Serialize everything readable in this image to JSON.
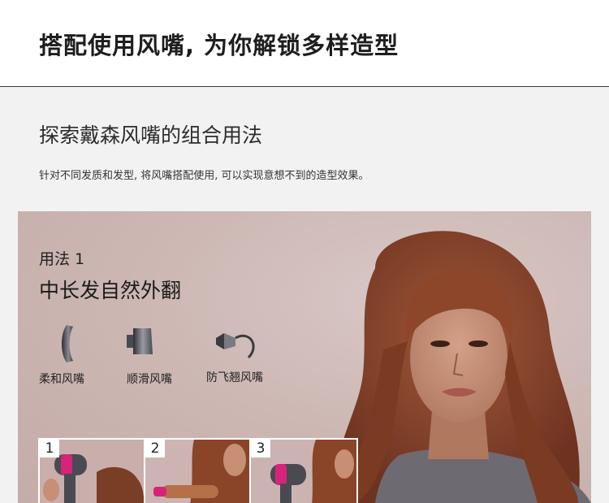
{
  "header": {
    "title": "搭配使用风嘴, 为你解锁多样造型"
  },
  "section": {
    "title": "探索戴森风嘴的组合用法",
    "description": "针对不同发质和发型, 将风嘴搭配使用, 可以实现意想不到的造型效果。"
  },
  "usage": {
    "label": "用法 1",
    "title": "中长发自然外翻",
    "nozzles": [
      {
        "label": "柔和风嘴",
        "icon": "gentle-air-nozzle-icon"
      },
      {
        "label": "顺滑风嘴",
        "icon": "smoothing-nozzle-icon"
      },
      {
        "label": "防飞翘风嘴",
        "icon": "flyaway-nozzle-icon"
      }
    ],
    "steps": [
      {
        "number": "1"
      },
      {
        "number": "2"
      },
      {
        "number": "3"
      }
    ]
  },
  "colors": {
    "hero_background": "#cdb8b4",
    "hair": "#8a4428",
    "dryer_pink": "#d6247a",
    "dryer_body": "#4a4a52"
  }
}
